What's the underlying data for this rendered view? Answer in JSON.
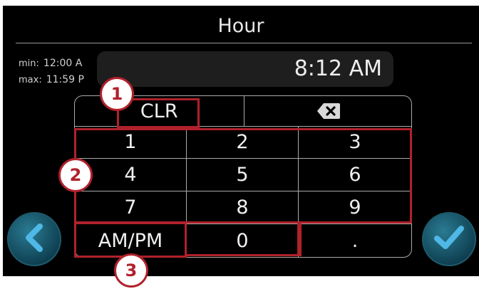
{
  "header": {
    "title": "Hour"
  },
  "limits": {
    "min_label": "min:",
    "min_value": "12:00 A",
    "max_label": "max:",
    "max_value": "11:59 P"
  },
  "display": {
    "value": "8:12 AM"
  },
  "keypad": {
    "clear_label": "CLR",
    "keys": [
      "1",
      "2",
      "3",
      "4",
      "5",
      "6",
      "7",
      "8",
      "9",
      "AM/PM",
      "0",
      "."
    ]
  },
  "callouts": [
    "1",
    "2",
    "3"
  ],
  "icons": {
    "back": "chevron-left-icon",
    "confirm": "checkmark-icon",
    "backspace": "backspace-icon"
  },
  "colors": {
    "highlight": "#b0212b",
    "accent": "#2a9fd6",
    "background": "#000000"
  }
}
